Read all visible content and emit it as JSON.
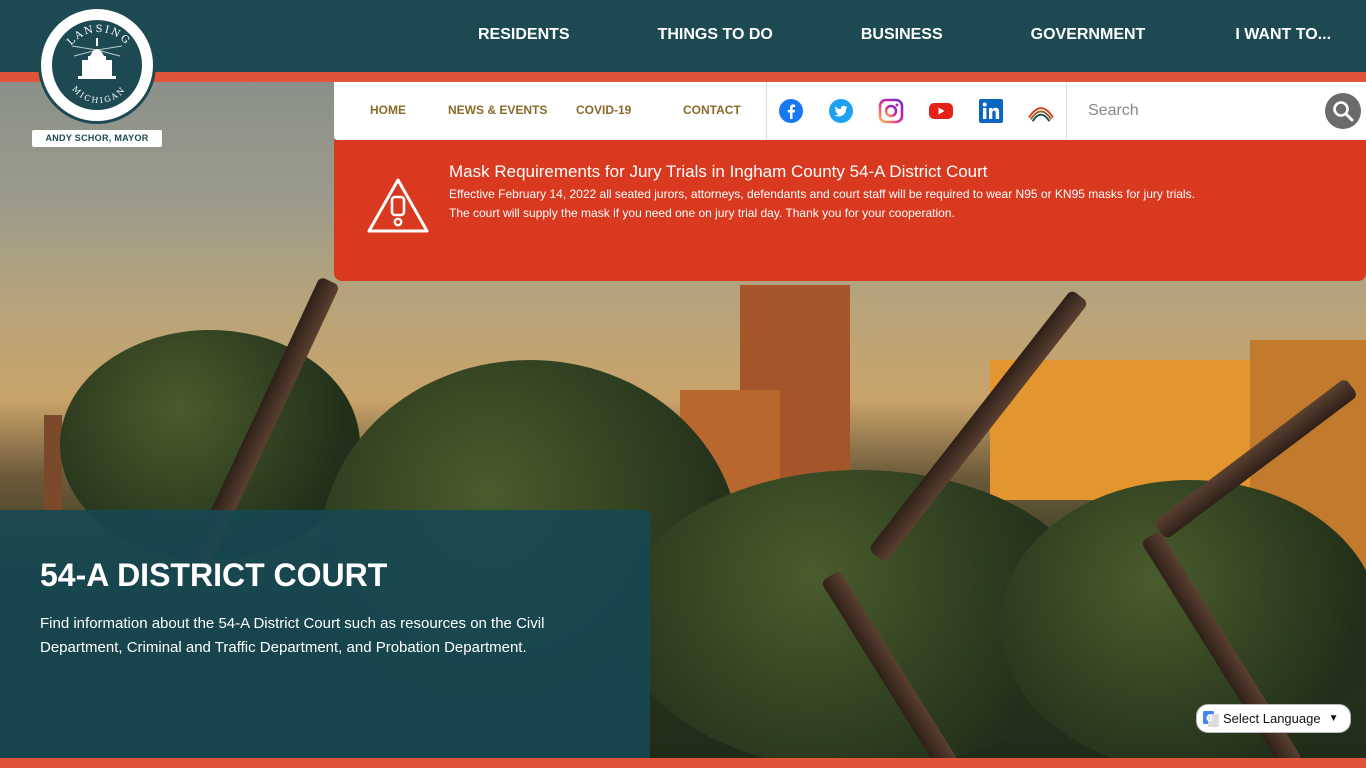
{
  "header": {
    "nav": [
      {
        "label": "RESIDENTS"
      },
      {
        "label": "THINGS TO DO"
      },
      {
        "label": "BUSINESS"
      },
      {
        "label": "GOVERNMENT"
      },
      {
        "label": "I WANT TO..."
      }
    ],
    "seal_text_top": "LANSING",
    "seal_text_bottom": "MICHIGAN",
    "mayor_label": "ANDY SCHOR, MAYOR"
  },
  "subnav": {
    "items": [
      {
        "label": "HOME"
      },
      {
        "label": "NEWS & EVENTS"
      },
      {
        "label": "COVID-19"
      },
      {
        "label": "CONTACT"
      }
    ],
    "social": [
      {
        "icon": "facebook-icon",
        "color": "#1877f2"
      },
      {
        "icon": "twitter-icon",
        "color": "#1da1f2"
      },
      {
        "icon": "instagram-icon",
        "color": "#d6249f"
      },
      {
        "icon": "youtube-icon",
        "color": "#e62117"
      },
      {
        "icon": "linkedin-icon",
        "color": "#0a66c2"
      },
      {
        "icon": "lansing-wave-icon",
        "color": "#d8391f"
      }
    ],
    "search_placeholder": "Search"
  },
  "alert": {
    "title": "Mask Requirements for Jury Trials in Ingham County 54-A District Court",
    "line1": "Effective February 14, 2022 all seated jurors, attorneys, defendants and court staff will be required to wear N95 or KN95 masks for jury trials.",
    "line2": "The court will supply the mask if you need one on jury trial day.  Thank you for your cooperation.",
    "color": "#d8391f"
  },
  "panel": {
    "title": "54-A DISTRICT COURT",
    "description": "Find information about the 54-A District Court such as resources on the Civil Department, Criminal and Traffic Department, and Probation Department."
  },
  "translate": {
    "label": "Select Language"
  },
  "colors": {
    "brand_teal": "#1d4a52",
    "accent_orange": "#e0553a",
    "nav_gold": "#8a6a2a"
  }
}
